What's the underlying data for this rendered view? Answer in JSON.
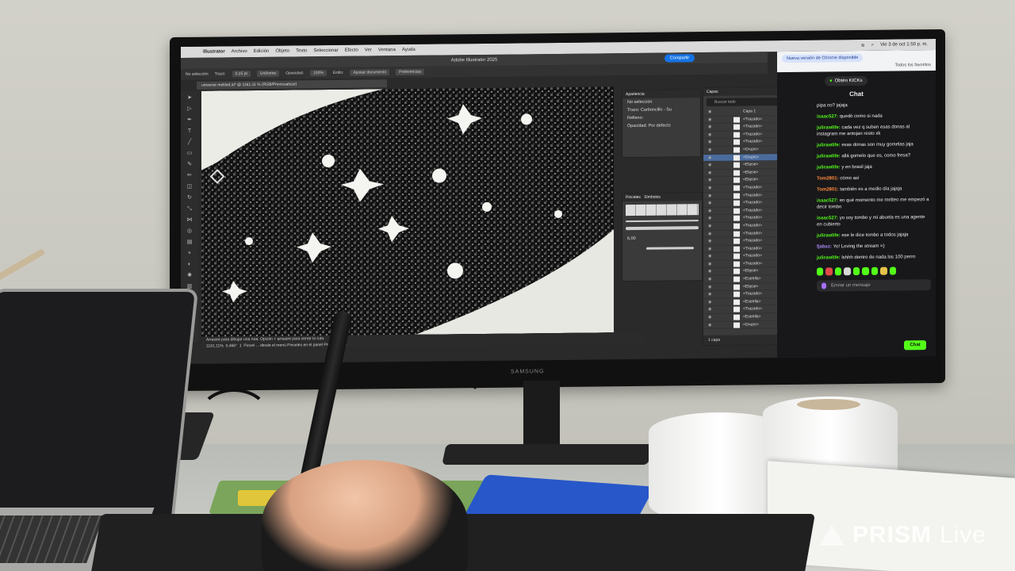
{
  "menubar": {
    "items": [
      "Illustrator",
      "Archivo",
      "Edición",
      "Objeto",
      "Texto",
      "Seleccionar",
      "Efecto",
      "Ver",
      "Ventana",
      "Ayuda"
    ],
    "clock": "Vie 3 de oct  1:50 p. m."
  },
  "illustrator": {
    "window_title": "Adobe Illustrator 2025",
    "share_label": "Compartir",
    "control": {
      "no_selection": "No selección",
      "stroke_label": "Trazo:",
      "stroke_value": "0,25 pt",
      "uniform": "Uniforme",
      "opacity_label": "Opacidad:",
      "opacity_value": "100%",
      "style_label": "Estilo:",
      "adjust_doc": "Ajustar documento",
      "prefs": "Preferencias"
    },
    "doc_tab": "universe meltied.ai* @ 1161,11 % (RGB/Previsualizar)",
    "status": {
      "line1": "Arrastre para dibujar una ruta. Opción + arrastre para cerrar la ruta.",
      "line2": "Pincel ... desde el menú Pinceles en el panel Propiedades.",
      "zoom": "1161,11%",
      "angle": "0,466°",
      "artboard": "1"
    }
  },
  "appearance_panel": {
    "title": "Apariencia",
    "rows": [
      "No selección",
      "Trazo: Carboncillo - Su",
      "Relleno:",
      "Opacidad: Por defecto"
    ]
  },
  "brushes_panel": {
    "tabs": [
      "Pinceles",
      "Símbolos"
    ],
    "size_label": "6,00"
  },
  "layers_panel": {
    "title": "Capas",
    "search_placeholder": "Buscar todo",
    "layer_name": "Capa 1",
    "rows": [
      "<Trazado>",
      "<Trazado>",
      "<Trazado>",
      "<Trazado>",
      "<Grupo>",
      "<Grupo>",
      "<Elipse>",
      "<Elipse>",
      "<Elipse>",
      "<Trazado>",
      "<Trazado>",
      "<Trazado>",
      "<Trazado>",
      "<Trazado>",
      "<Trazado>",
      "<Trazado>",
      "<Trazado>",
      "<Trazado>",
      "<Trazado>",
      "<Trazado>",
      "<Elipse>",
      "<Estrella>",
      "<Elipse>",
      "<Trazado>",
      "<Estrella>",
      "<Trazado>",
      "<Estrella>",
      "<Grupo>"
    ],
    "footer": "1 capa"
  },
  "chrome": {
    "update_badge": "Nueva versión de Chrome disponible",
    "favorites": "Todos los favoritos"
  },
  "chat": {
    "kicks_button": "Obtén KICKs",
    "title": "Chat",
    "input_placeholder": "Enviar un mensaje",
    "send_label": "Chat",
    "messages": [
      {
        "user": "",
        "text": "pipa no? jajaja",
        "color": "#efeff1"
      },
      {
        "user": "isaac527:",
        "text": "quedó como si nada",
        "color": "#53fc18"
      },
      {
        "user": "julirawlife:",
        "text": "cada vez q suben esas donas al instagram me antojan resto xk",
        "color": "#53fc18"
      },
      {
        "user": "julirawlife:",
        "text": "esas donas son muy gomelas jaja",
        "color": "#53fc18"
      },
      {
        "user": "julirawlife:",
        "text": "allá gomelo que es, como fresa?",
        "color": "#53fc18"
      },
      {
        "user": "julirawlife:",
        "text": "y en brasil jaja",
        "color": "#53fc18"
      },
      {
        "user": "Tom2801:",
        "text": "cómo así",
        "color": "#ff8b3d"
      },
      {
        "user": "Tom2801:",
        "text": "también es a medio día jajaja",
        "color": "#ff8b3d"
      },
      {
        "user": "isaac527:",
        "text": "en qué momento me melteo me empezó a decir tombo",
        "color": "#53fc18"
      },
      {
        "user": "isaac527:",
        "text": "yo soy tombo y mi abuela es una agente en cubierto",
        "color": "#53fc18"
      },
      {
        "user": "julirawlife:",
        "text": "ese le dice tombo a todos jajaja",
        "color": "#53fc18"
      },
      {
        "user": "fjabxz:",
        "text": "Yo! Loving the stream =)",
        "color": "#b18cff"
      },
      {
        "user": "julirawlife:",
        "text": "lshhh dentro de nada los 100 perro",
        "color": "#53fc18"
      }
    ]
  },
  "monitor_brand": "SAMSUNG",
  "watermark": {
    "brand": "PRISM",
    "suffix": "Live"
  }
}
